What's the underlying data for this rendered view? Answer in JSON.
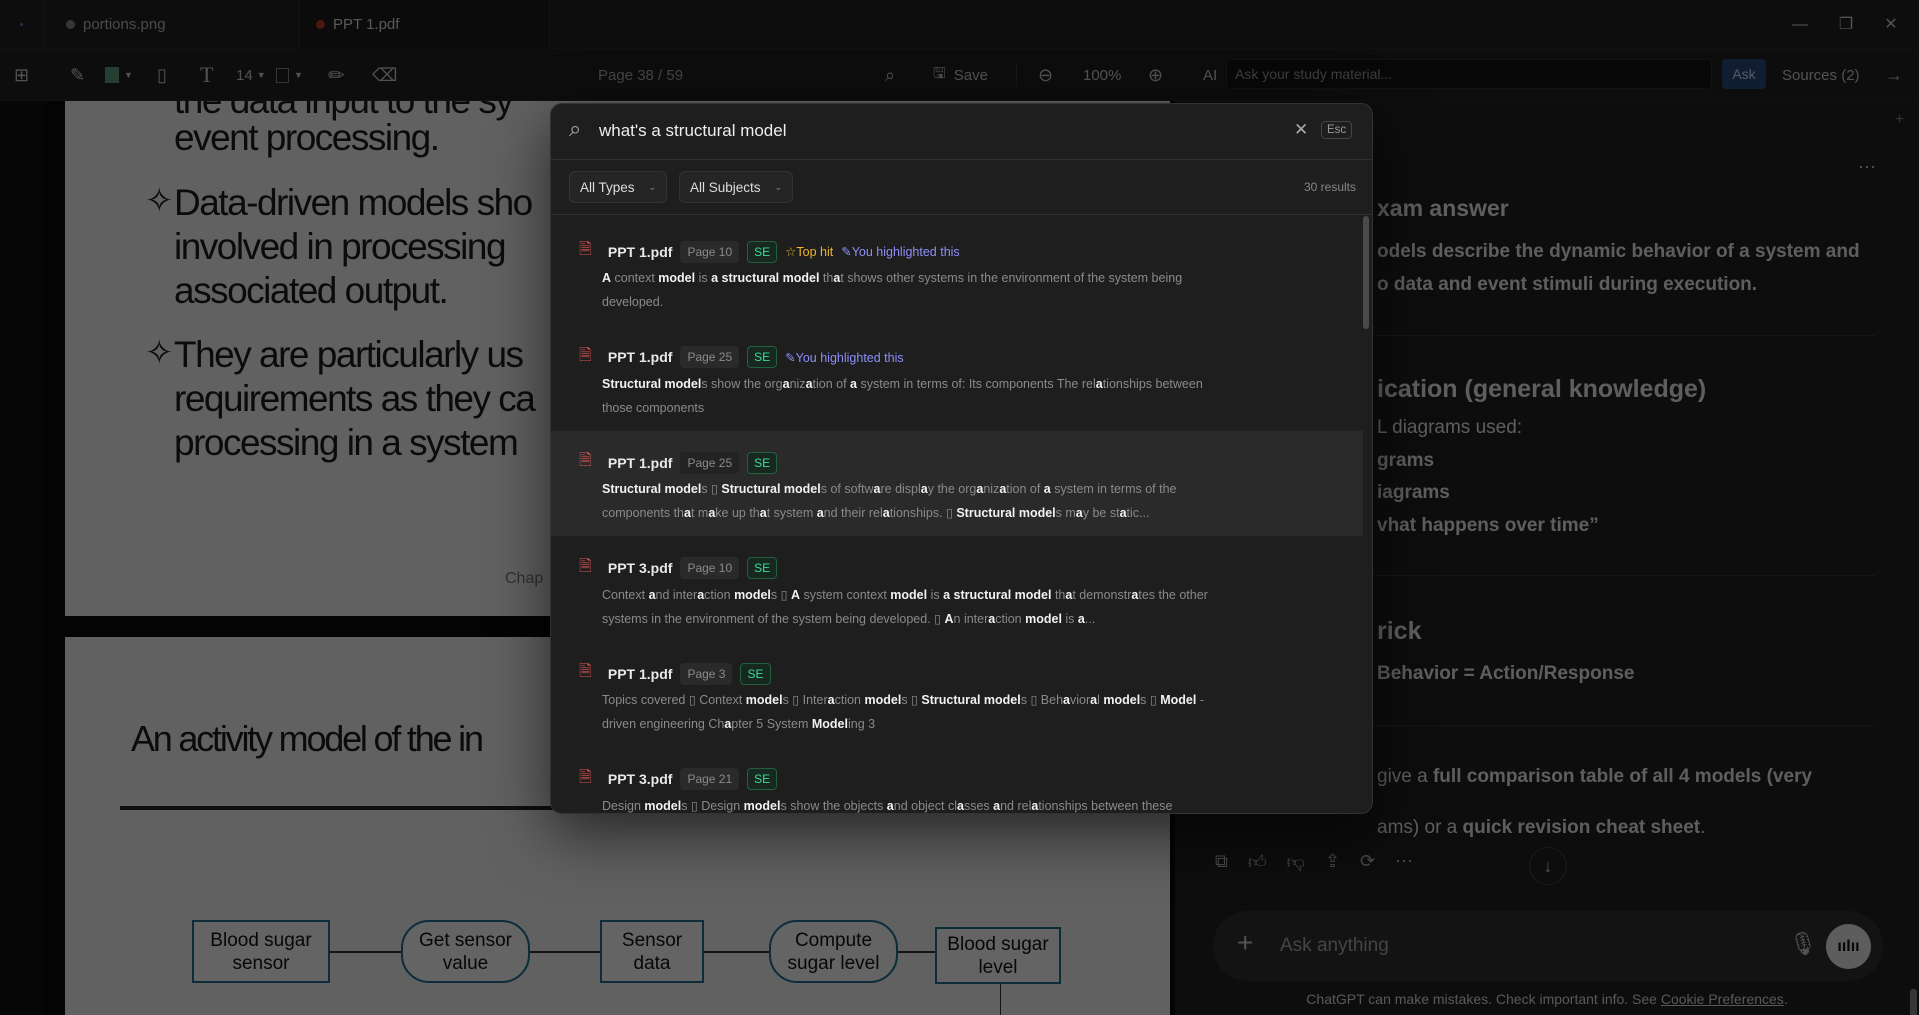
{
  "titlebar": {
    "tabs": [
      {
        "label": "portions.png",
        "dot_color": "#888888"
      },
      {
        "label": "PPT 1.pdf",
        "dot_color": "#c0392b"
      }
    ]
  },
  "toolbar": {
    "font_size": "14",
    "page_indicator": "Page 38 / 59",
    "save_label": "Save",
    "zoom": "100%",
    "ai_label": "AI",
    "ai_placeholder": "Ask your study material...",
    "ask_label": "Ask",
    "sources_label": "Sources (2)",
    "color_swatch": "#5a9a7a"
  },
  "pdf": {
    "page1": {
      "top_line": "the data input to the sy",
      "lines": [
        "event processing.",
        "Data-driven models sho",
        "involved in processing",
        "associated output.",
        "They are particularly us",
        "requirements as they ca",
        "processing in a system"
      ],
      "footer": "Chap"
    },
    "page2": {
      "title": "An activity model of the in",
      "diagram": [
        "Blood sugar sensor",
        "Get sensor value",
        "Sensor data",
        "Compute sugar level",
        "Blood sugar level"
      ]
    }
  },
  "chat": {
    "h1": "xam answer",
    "p1a": "odels describe the dynamic behavior of a system and",
    "p1b": "o data and event stimuli during execution.",
    "h2": "ication (general knowledge)",
    "l1": "L diagrams used:",
    "l2": "grams",
    "l3": "iagrams",
    "l4": "vhat happens over time”",
    "h3": "rick",
    "p3": "Behavior = Action/Response",
    "p4a_pre": "give a ",
    "p4a_bold": "full comparison table of all 4 models (very",
    "p4b_pre": "ams) or a ",
    "p4b_bold": "quick revision cheat sheet",
    "p4b_post": ".",
    "input_placeholder": "Ask anything",
    "disclaimer": "ChatGPT can make mistakes. Check important info. See ",
    "disclaimer_link": "Cookie Preferences",
    "disclaimer_end": "."
  },
  "search": {
    "query": "what's a structural model",
    "esc_label": "Esc",
    "filters": [
      "All Types",
      "All Subjects"
    ],
    "result_count": "30 results",
    "colors": {
      "top_hit": "#f0b429",
      "highlight": "#8c8ff7",
      "subject": "#3ddc97",
      "file_icon": "#e05555"
    },
    "results": [
      {
        "file": "PPT 1.pdf",
        "page": "Page 10",
        "subject": "SE",
        "top_hit": "Top hit",
        "highlighted": "You highlighted this",
        "snippet": "**A** context **model** is **a structural model** th**a**t shows other systems in the environment of the system being developed."
      },
      {
        "file": "PPT 1.pdf",
        "page": "Page 25",
        "subject": "SE",
        "highlighted": "You highlighted this",
        "snippet": "**Structural model**s show the org**a**niz**a**tion of **a** system in terms of: Its components The rel**a**tionships between those components"
      },
      {
        "file": "PPT 1.pdf",
        "page": "Page 25",
        "subject": "SE",
        "active": true,
        "snippet": "**Structural model**s ▯ **Structural model**s of softw**a**re displ**a**y the org**a**niz**a**tion of **a** system in terms of the components th**a**t m**a**ke up th**a**t system **a**nd their rel**a**tionships. ▯ **Structural model**s m**a**y be st**a**tic..."
      },
      {
        "file": "PPT 3.pdf",
        "page": "Page 10",
        "subject": "SE",
        "snippet": "Context **a**nd inter**a**ction **model**s ▯ **A** system context **model** is **a structural model** th**a**t demonstr**a**tes the other systems in the environment of the system being developed. ▯ **A**n inter**a**ction **model** is **a**..."
      },
      {
        "file": "PPT 1.pdf",
        "page": "Page 3",
        "subject": "SE",
        "snippet": "Topics covered ▯ Context **model**s ▯ Inter**a**ction **model**s ▯ **Structural model**s ▯ Beh**a**vior**a**l **model**s ▯ **Model** - driven engineering Ch**a**pter 5 System **Model**ing 3"
      },
      {
        "file": "PPT 3.pdf",
        "page": "Page 21",
        "subject": "SE",
        "snippet": "Design **model**s ▯ Design **model**s show the objects **a**nd object cl**a**sses **a**nd rel**a**tionships between these"
      }
    ]
  }
}
